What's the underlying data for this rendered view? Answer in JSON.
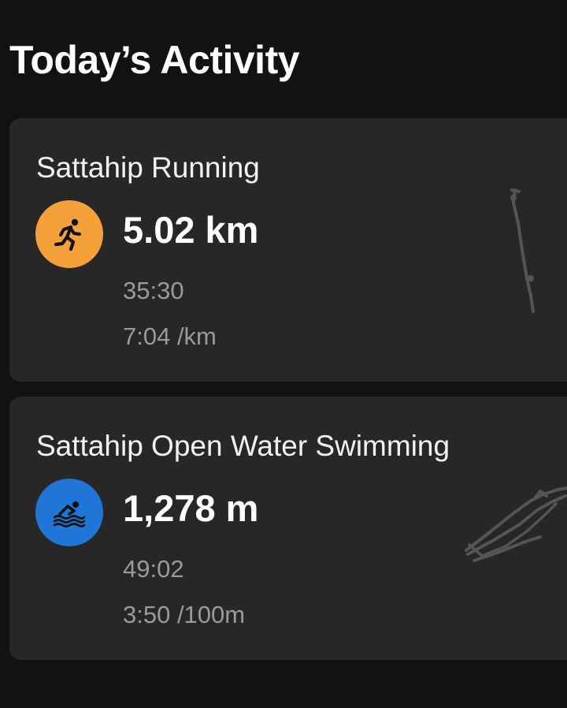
{
  "header": {
    "title": "Today’s Activity"
  },
  "activities": [
    {
      "title": "Sattahip Running",
      "icon": "running-icon",
      "icon_color": "#f5a03a",
      "distance": "5.02 km",
      "duration": "35:30",
      "pace": "7:04 /km"
    },
    {
      "title": "Sattahip Open Water Swimming",
      "icon": "swimming-icon",
      "icon_color": "#1f76d6",
      "distance": "1,278 m",
      "duration": "49:02",
      "pace": "3:50 /100m"
    }
  ],
  "colors": {
    "background": "#121212",
    "card": "#272727",
    "route": "#555555"
  }
}
